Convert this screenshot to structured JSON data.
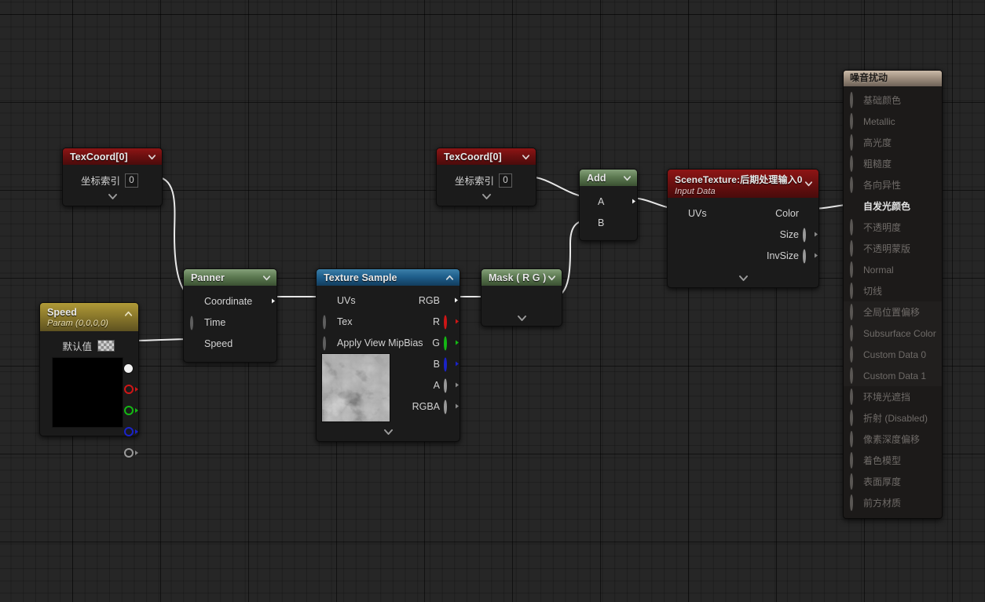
{
  "editor": {
    "name": "unreal-material-graph",
    "background_color": "#262626",
    "grid_minor_color": "#1c1c1c",
    "grid_major_color": "#0d0d0d",
    "wire_color": "#e8e8e8"
  },
  "nodes": {
    "texcoord_1": {
      "title": "TexCoord[0]",
      "header_color": "#6d1010",
      "param_label": "坐标索引",
      "param_value": "0",
      "expand_caret": "chevron-down-icon",
      "footer_caret": "chevron-down-icon"
    },
    "texcoord_2": {
      "title": "TexCoord[0]",
      "header_color": "#6d1010",
      "param_label": "坐标索引",
      "param_value": "0",
      "expand_caret": "chevron-down-icon",
      "footer_caret": "chevron-down-icon"
    },
    "speed": {
      "title": "Speed",
      "subtitle": "Param (0,0,0,0)",
      "header_color": "#8c7a2c",
      "value_label": "默认值",
      "swatch": "checkerboard-swatch",
      "expand_caret": "chevron-up-icon",
      "out_pins": [
        "RGBA",
        "R",
        "G",
        "B",
        "A"
      ]
    },
    "panner": {
      "title": "Panner",
      "header_color": "#5d7a52",
      "inputs": [
        "Coordinate",
        "Time",
        "Speed"
      ],
      "outputs": [
        "out"
      ],
      "expand_caret": "chevron-down-icon"
    },
    "texture_sample": {
      "title": "Texture Sample",
      "header_color": "#1f5f8c",
      "inputs": [
        "UVs",
        "Tex",
        "Apply View MipBias"
      ],
      "outputs": [
        "RGB",
        "R",
        "G",
        "B",
        "A",
        "RGBA"
      ],
      "expand_caret": "chevron-up-icon",
      "footer_caret": "chevron-down-icon",
      "thumbnail": "noise-texture-thumbnail"
    },
    "mask": {
      "title": "Mask ( R G )",
      "header_color": "#5d7a52",
      "expand_caret": "chevron-down-icon",
      "footer_caret": "chevron-down-icon"
    },
    "add": {
      "title": "Add",
      "header_color": "#5d7a52",
      "inputs": [
        "A",
        "B"
      ],
      "expand_caret": "chevron-down-icon"
    },
    "scene_texture": {
      "title": "SceneTexture:后期处理输入0",
      "subtitle": "Input Data",
      "header_color": "#6d1010",
      "inputs": [
        "UVs"
      ],
      "outputs": [
        "Color",
        "Size",
        "InvSize"
      ],
      "expand_caret": "chevron-down-icon",
      "footer_caret": "chevron-down-icon"
    },
    "material_output": {
      "title": "噪音扰动",
      "header_color": "#9e8e7e",
      "pins": [
        {
          "label": "基础颜色",
          "connected": false
        },
        {
          "label": "Metallic",
          "connected": false
        },
        {
          "label": "高光度",
          "connected": false
        },
        {
          "label": "粗糙度",
          "connected": false
        },
        {
          "label": "各向异性",
          "connected": false
        },
        {
          "label": "自发光颜色",
          "connected": true
        },
        {
          "label": "不透明度",
          "connected": false
        },
        {
          "label": "不透明蒙版",
          "connected": false
        },
        {
          "label": "Normal",
          "connected": false
        },
        {
          "label": "切线",
          "connected": false
        },
        {
          "label": "全局位置偏移",
          "connected": false
        },
        {
          "label": "Subsurface Color",
          "connected": false
        },
        {
          "label": "Custom Data 0",
          "connected": false
        },
        {
          "label": "Custom Data 1",
          "connected": false
        },
        {
          "label": "环境光遮挡",
          "connected": false
        },
        {
          "label": "折射 (Disabled)",
          "connected": false
        },
        {
          "label": "像素深度偏移",
          "connected": false
        },
        {
          "label": "着色模型",
          "connected": false
        },
        {
          "label": "表面厚度",
          "connected": false
        },
        {
          "label": "前方材质",
          "connected": false
        }
      ]
    }
  },
  "connections": [
    {
      "from": "texcoord_1.out",
      "to": "panner.Coordinate"
    },
    {
      "from": "speed.RGBA",
      "to": "panner.Speed"
    },
    {
      "from": "panner.out",
      "to": "texture_sample.UVs"
    },
    {
      "from": "texture_sample.RGB",
      "to": "mask.in"
    },
    {
      "from": "texcoord_2.out",
      "to": "add.A"
    },
    {
      "from": "mask.out",
      "to": "add.B"
    },
    {
      "from": "add.out",
      "to": "scene_texture.UVs"
    },
    {
      "from": "scene_texture.Color",
      "to": "material_output.自发光颜色"
    }
  ]
}
